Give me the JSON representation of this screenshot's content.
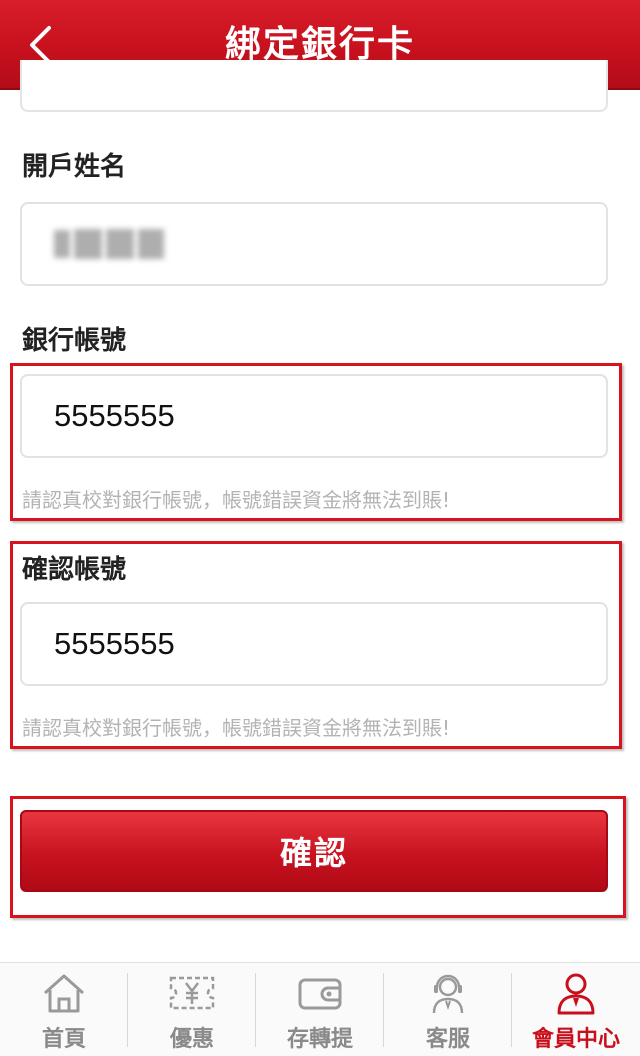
{
  "header": {
    "title": "綁定銀行卡"
  },
  "form": {
    "account_name": {
      "label": "開戶姓名"
    },
    "account_number": {
      "label": "銀行帳號",
      "value": "5555555",
      "hint": "請認真校對銀行帳號，帳號錯誤資金將無法到賬!"
    },
    "confirm_number": {
      "label": "確認帳號",
      "value": "5555555",
      "hint": "請認真校對銀行帳號，帳號錯誤資金將無法到賬!"
    }
  },
  "confirm_button": {
    "label": "確認"
  },
  "tabbar": {
    "items": [
      {
        "label": "首頁",
        "icon": "home-icon"
      },
      {
        "label": "優惠",
        "icon": "coupon-icon"
      },
      {
        "label": "存轉提",
        "icon": "wallet-icon"
      },
      {
        "label": "客服",
        "icon": "support-agent-icon"
      },
      {
        "label": "會員中心",
        "icon": "member-icon",
        "active": true
      }
    ]
  },
  "colors": {
    "brand_red": "#c8101d",
    "hint_gray": "#b3b3b3",
    "tab_gray": "#8a8a8a"
  }
}
